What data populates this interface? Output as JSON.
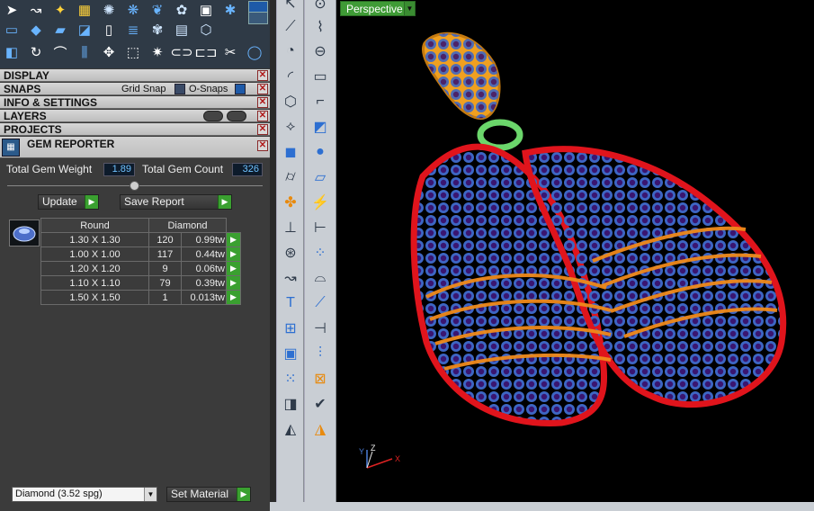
{
  "toolbar": {
    "row1_icons": [
      "arrow-icon",
      "curve-icon",
      "snap-star-icon",
      "grid-snap-icon",
      "gem-sparkle-icon",
      "gem-cluster-icon",
      "leaf-icon",
      "flower-icon",
      "camera-icon",
      "settings-flower-icon"
    ],
    "row2_icons": [
      "tile-icon",
      "diamond-icon",
      "page-icon",
      "bevel-icon",
      "file-icon",
      "stack-icon",
      "flower-gear-icon",
      "window-icon",
      "hex-grid-icon"
    ],
    "row3_icons": [
      "cubes-icon",
      "rotate-icon",
      "pen-curve-icon",
      "mirror-icon",
      "move-icon",
      "shape-icon",
      "explode-icon",
      "link-icon",
      "split-icon",
      "cut-icon",
      "circle-icon"
    ]
  },
  "sections": {
    "display": "DISPLAY",
    "snaps": "SNAPS",
    "grid_snap": "Grid Snap",
    "o_snaps": "O-Snaps",
    "info_settings": "INFO & SETTINGS",
    "layers": "LAYERS",
    "projects": "PROJECTS",
    "gem_reporter": "GEM REPORTER"
  },
  "gem_reporter": {
    "total_weight_label": "Total Gem Weight",
    "total_weight_value": "1.89",
    "total_count_label": "Total Gem Count",
    "total_count_value": "326",
    "update_label": "Update",
    "save_report_label": "Save Report",
    "table": {
      "col_shape": "Round",
      "col_material": "Diamond",
      "rows": [
        {
          "size": "1.30 X 1.30",
          "count": "120",
          "weight": "0.99tw"
        },
        {
          "size": "1.00 X 1.00",
          "count": "117",
          "weight": "0.44tw"
        },
        {
          "size": "1.20 X 1.20",
          "count": "9",
          "weight": "0.06tw"
        },
        {
          "size": "1.10 X 1.10",
          "count": "79",
          "weight": "0.39tw"
        },
        {
          "size": "1.50 X 1.50",
          "count": "1",
          "weight": "0.013tw"
        }
      ]
    }
  },
  "material": {
    "selected": "Diamond    (3.52 spg)",
    "set_label": "Set Material"
  },
  "viewport": {
    "view_name": "Perspective",
    "axis_y": "Y",
    "axis_z": "Z",
    "axis_x": "X"
  },
  "colors": {
    "accent_green": "#3f9b36",
    "frame_red": "#e0141c",
    "gem_purple": "#5a2a9a",
    "gem_light": "#7fb6ff",
    "gold": "#f0a020"
  }
}
